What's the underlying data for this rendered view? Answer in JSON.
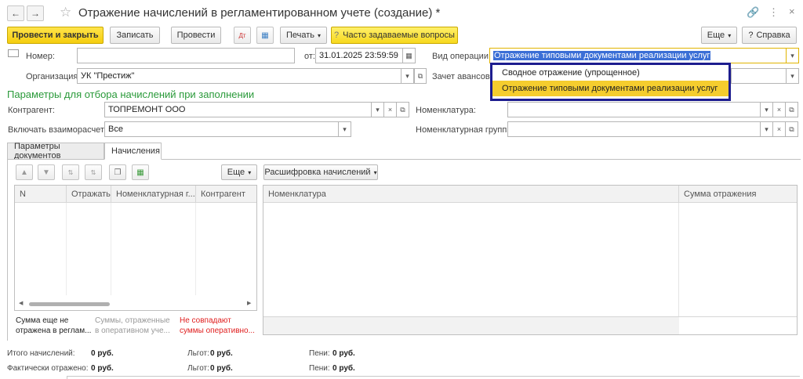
{
  "window": {
    "title": "Отражение начислений в регламентированном учете (создание) *",
    "back_icon": "arrow-left-icon",
    "forward_icon": "arrow-right-icon",
    "star_icon": "star-icon",
    "link_icon": "link-icon",
    "menu_icon": "more-vertical-icon",
    "restore_icon": "restore-icon",
    "close_icon": "close-icon"
  },
  "toolbar": {
    "post_close": "Провести и закрыть",
    "save": "Записать",
    "post": "Провести",
    "print": "Печать",
    "faq": "Часто задаваемые вопросы",
    "more": "Еще",
    "help": "Справка"
  },
  "form": {
    "number_label": "Номер:",
    "number_value": "",
    "date_label": "от:",
    "date_value": "31.01.2025 23:59:59",
    "operation_label": "Вид операции:",
    "operation_value": "Отражение типовыми документами реализации услуг",
    "org_label": "Организация:",
    "org_value": "УК \"Престиж\"",
    "offset_label": "Зачет авансов",
    "section_title": "Параметры для отбора начислений при заполнении",
    "contractor_label": "Контрагент:",
    "contractor_value": "ТОПРЕМОНТ ООО",
    "nomenclature_label": "Номенклатура:",
    "settlements_label": "Включать взаиморасчеты:",
    "settlements_value": "Все",
    "nomgroup_label": "Номенклатурная группа:"
  },
  "dropdown": {
    "options": [
      "Сводное отражение (упрощенное)",
      "Отражение типовыми документами реализации услуг"
    ],
    "selected_index": 1
  },
  "tabs": [
    "Параметры документов",
    "Начисления"
  ],
  "active_tab": 1,
  "grid_toolbar": {
    "more": "Еще",
    "decode": "Расшифровка начислений"
  },
  "left_grid": {
    "columns": [
      "N",
      "Отражать",
      "Номенклатурная г...",
      "Контрагент"
    ]
  },
  "right_grid": {
    "columns": [
      "Номенклатура",
      "Сумма отражения"
    ]
  },
  "legend": {
    "item1": [
      "Сумма еще не",
      "отражена в реглам..."
    ],
    "item2": [
      "Суммы, отраженные",
      "в оперативном уче..."
    ],
    "item3": [
      "Не совпадают",
      "суммы оперативно..."
    ],
    "item3_color": "#e02020"
  },
  "totals": {
    "accrued_label": "Итого начислений:",
    "accrued_value": "0 руб.",
    "actual_label": "Фактически отражено:",
    "actual_value": "0 руб.",
    "benefit_label": "Льгот:",
    "benefit_value1": "0 руб.",
    "benefit_value2": "0 руб.",
    "penalty_label": "Пени:",
    "penalty_value1": "0 руб.",
    "penalty_value2": "0 руб."
  },
  "colors": {
    "accent_yellow": "#f5cd0f",
    "section_green": "#2a9a3a",
    "dropdown_border": "#1d1d8f"
  }
}
